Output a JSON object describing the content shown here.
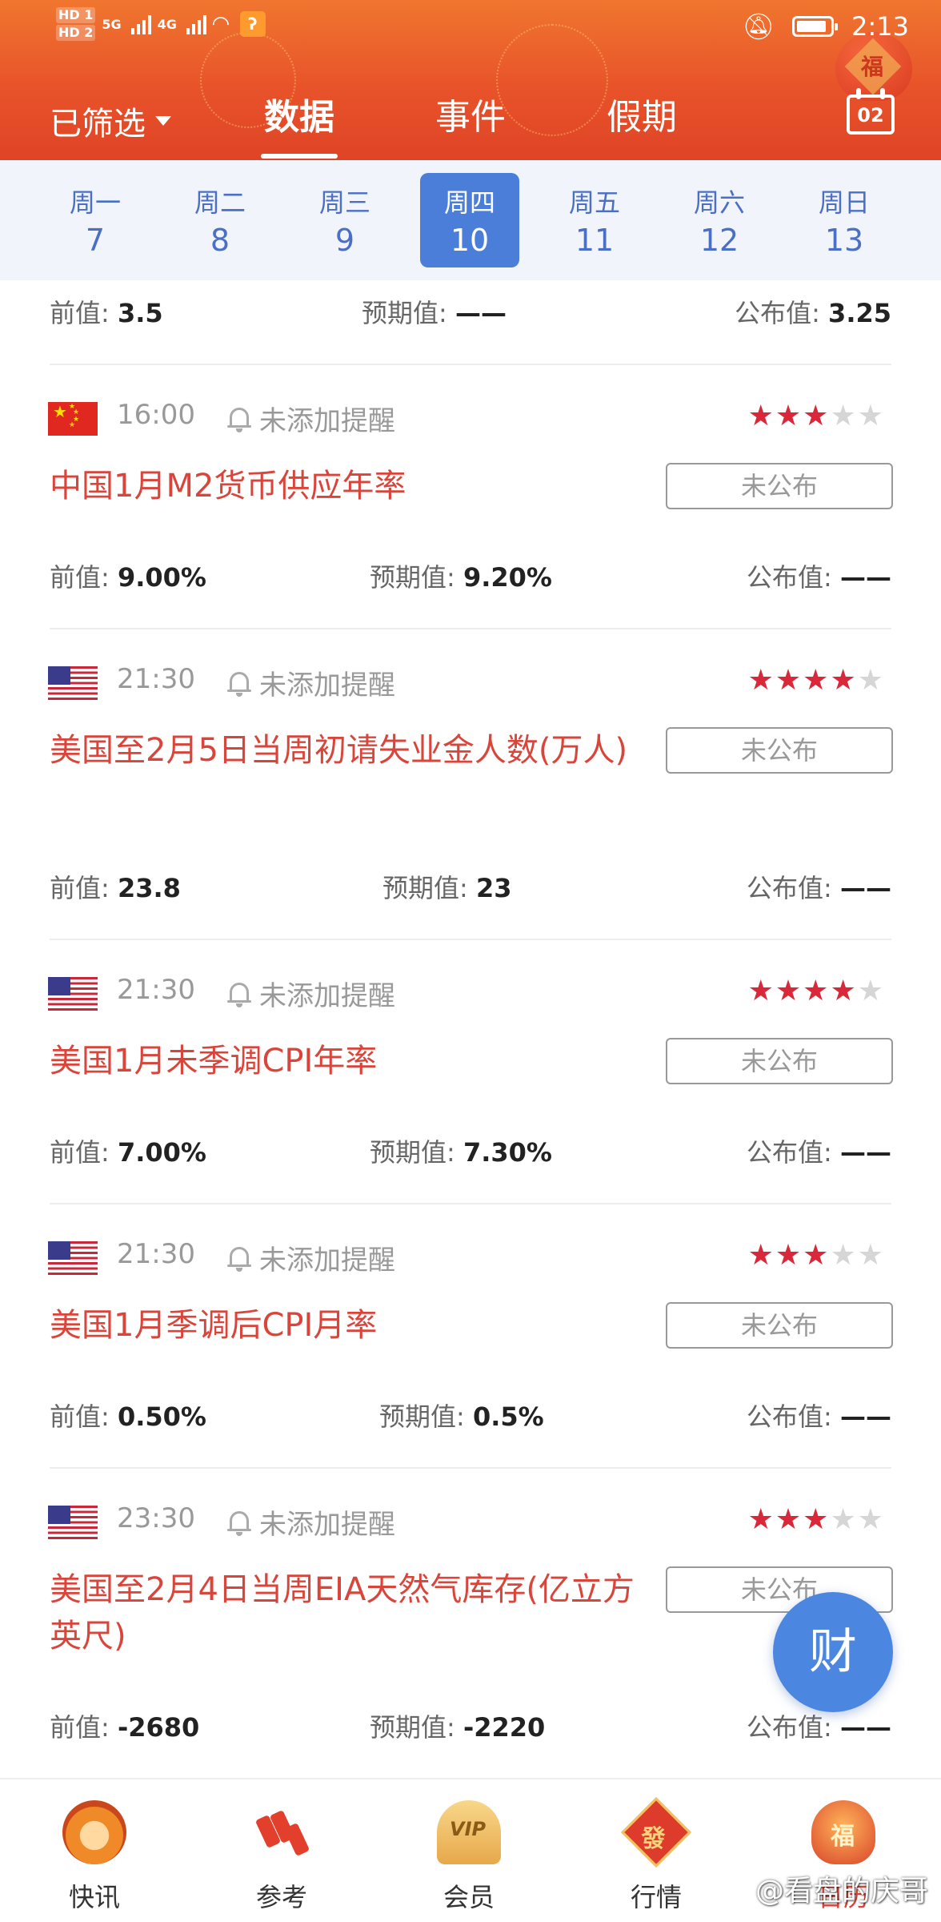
{
  "status_bar": {
    "hd1": "HD 1",
    "hd2": "HD 2",
    "net1": "5G",
    "net2": "4G",
    "time": "2:13"
  },
  "header": {
    "filter_label": "已筛选",
    "tabs": [
      "数据",
      "事件",
      "假期"
    ],
    "active_tab": 0,
    "calendar_day": "02",
    "lantern_char": "福"
  },
  "week": [
    {
      "name": "周一",
      "date": "7"
    },
    {
      "name": "周二",
      "date": "8"
    },
    {
      "name": "周三",
      "date": "9"
    },
    {
      "name": "周四",
      "date": "10"
    },
    {
      "name": "周五",
      "date": "11"
    },
    {
      "name": "周六",
      "date": "12"
    },
    {
      "name": "周日",
      "date": "13"
    }
  ],
  "active_day": 3,
  "labels": {
    "prev": "前值:",
    "forecast": "预期值:",
    "actual": "公布值:",
    "remind": "未添加提醒",
    "unpublished": "未公布"
  },
  "top_partial": {
    "prev": "3.5",
    "forecast": "——",
    "actual": "3.25"
  },
  "events": [
    {
      "country": "CN",
      "time": "16:00",
      "stars": 3,
      "title": "中国1月M2货币供应年率",
      "prev": "9.00%",
      "forecast": "9.20%",
      "actual": "——"
    },
    {
      "country": "US",
      "time": "21:30",
      "stars": 4,
      "title": "美国至2月5日当周初请失业金人数(万人)",
      "prev": "23.8",
      "forecast": "23",
      "actual": "——"
    },
    {
      "country": "US",
      "time": "21:30",
      "stars": 4,
      "title": "美国1月未季调CPI年率",
      "prev": "7.00%",
      "forecast": "7.30%",
      "actual": "——"
    },
    {
      "country": "US",
      "time": "21:30",
      "stars": 3,
      "title": "美国1月季调后CPI月率",
      "prev": "0.50%",
      "forecast": "0.5%",
      "actual": "——"
    },
    {
      "country": "US",
      "time": "23:30",
      "stars": 3,
      "title": "美国至2月4日当周EIA天然气库存(亿立方英尺)",
      "prev": "-2680",
      "forecast": "-2220",
      "actual": "——"
    }
  ],
  "fab_label": "财",
  "bottom_nav": [
    {
      "label": "快讯",
      "icon": "tiger-icon"
    },
    {
      "label": "参考",
      "icon": "firecracker-icon"
    },
    {
      "label": "会员",
      "icon": "vip-fan-icon"
    },
    {
      "label": "行情",
      "icon": "fa-diamond-icon"
    },
    {
      "label": "日历",
      "icon": "fortune-bag-icon"
    }
  ],
  "active_bottom": 4,
  "icon_text": {
    "vip": "VIP",
    "fa": "發",
    "fu": "福"
  },
  "watermark": "@看盘的庆哥",
  "colors": {
    "accent_red": "#d9453a",
    "blue": "#4a7ed8",
    "header_orange": "#e8532a",
    "star_red": "#d8283a"
  }
}
